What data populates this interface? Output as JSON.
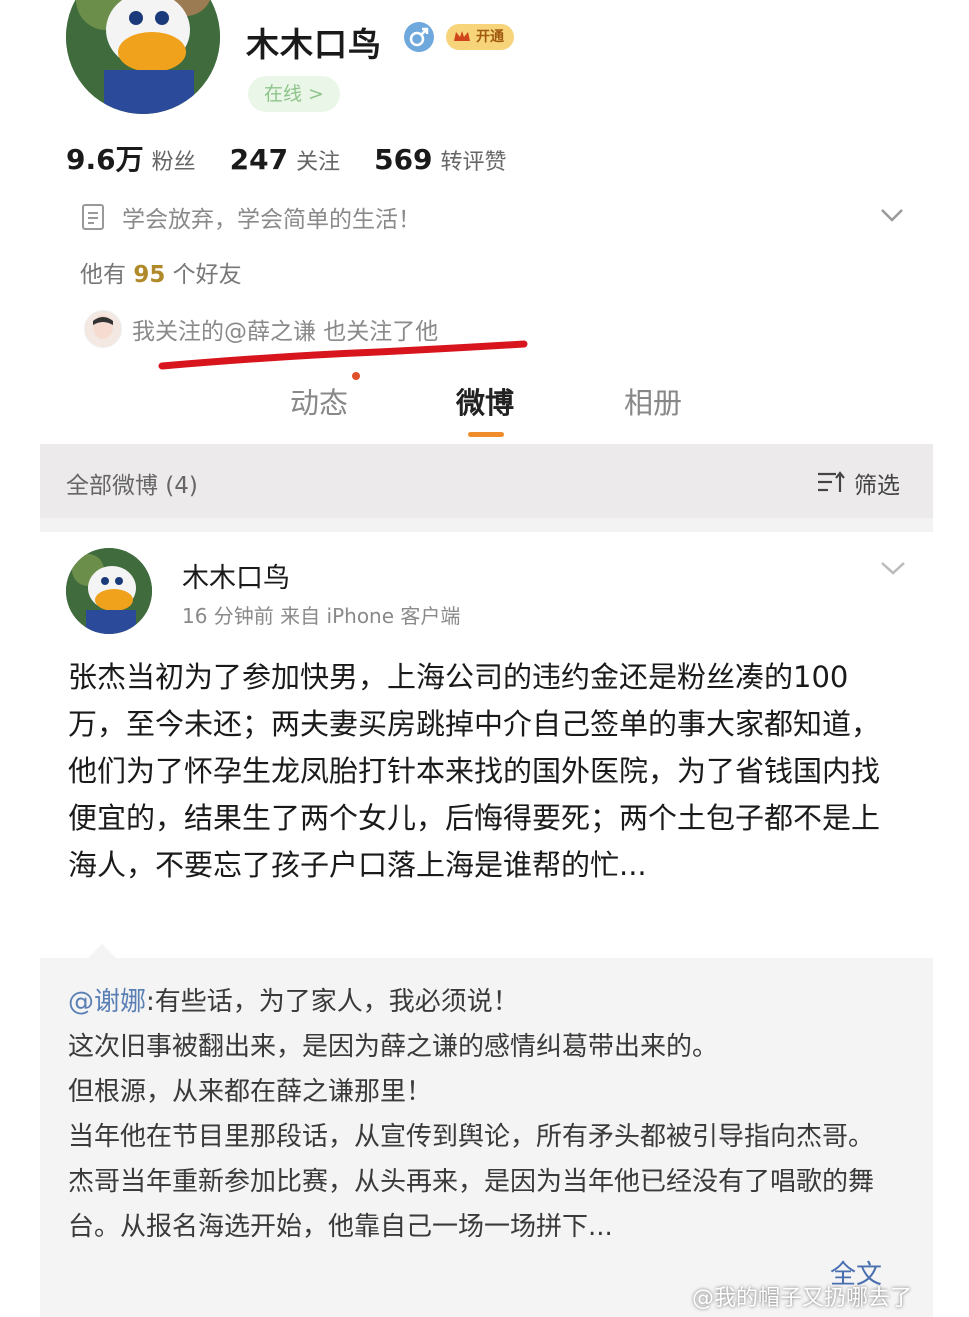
{
  "profile": {
    "name": "木木口鸟",
    "vip_label": "开通",
    "online_label": "在线 >",
    "stats": [
      {
        "value": "9.6万",
        "label": "粉丝"
      },
      {
        "value": "247",
        "label": "关注"
      },
      {
        "value": "569",
        "label": "转评赞"
      }
    ],
    "bio": "学会放弃，学会简单的生活！",
    "friends_prefix": "他有",
    "friends_count": "95",
    "friends_suffix": "个好友",
    "mutual_text": "我关注的@薛之谦 也关注了他"
  },
  "tabs": [
    {
      "label": "动态"
    },
    {
      "label": "微博"
    },
    {
      "label": "相册"
    }
  ],
  "filter": {
    "left_label": "全部微博 (4)",
    "right_label": "筛选"
  },
  "post": {
    "author": "木木口鸟",
    "meta": "16 分钟前  来自 iPhone 客户端",
    "body": "张杰当初为了参加快男，上海公司的违约金还是粉丝凑的100万，至今未还；两夫妻买房跳掉中介自己签单的事大家都知道，他们为了怀孕生龙凤胎打针本来找的国外医院，为了省钱国内找便宜的，结果生了两个女儿，后悔得要死；两个土包子都不是上海人，不要忘了孩子户口落上海是谁帮的忙...",
    "quote_mention": "@谢娜",
    "quote_text": ":有些话，为了家人，我必须说！\n这次旧事被翻出来，是因为薛之谦的感情纠葛带出来的。\n但根源，从来都在薛之谦那里！\n当年他在节目里那段话，从宣传到舆论，所有矛头都被引导指向杰哥。\n杰哥当年重新参加比赛，从头再来，是因为当年他已经没有了唱歌的舞台。从报名海选开始，他靠自己一场一场拼下...",
    "full_text_label": "全文"
  },
  "watermark": "@我的帽子又扔哪去了",
  "colors": {
    "accent_orange": "#f08c2a",
    "link_blue": "#4a6fb0",
    "red_underline": "#d8141c"
  }
}
